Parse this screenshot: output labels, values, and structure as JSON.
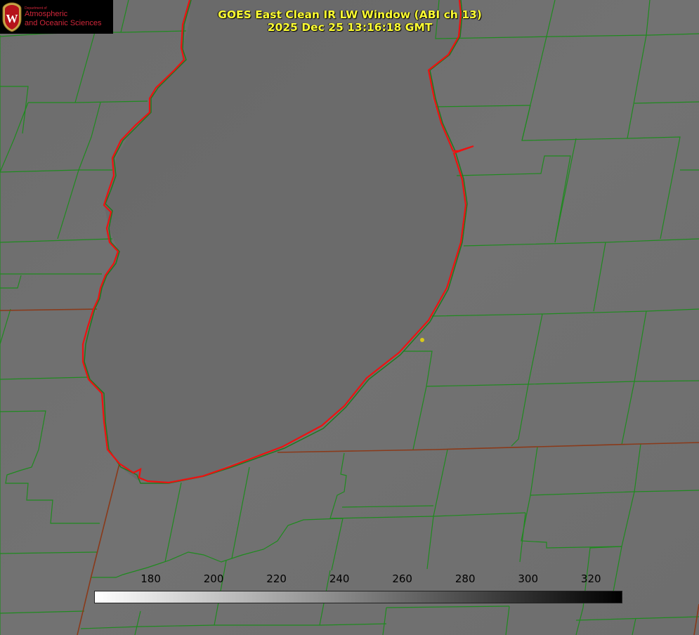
{
  "title": {
    "line1": "GOES East Clean IR LW Window (ABI ch 13)",
    "line2": "2025 Dec 25 13:16:18 GMT"
  },
  "logo": {
    "department": "Department of",
    "name_line1": "Atmospheric",
    "name_line2": "and Oceanic Sciences",
    "crest_letter": "W"
  },
  "colorbar": {
    "ticks": [
      "180",
      "200",
      "220",
      "240",
      "260",
      "280",
      "300",
      "320"
    ],
    "range": [
      162,
      330
    ],
    "gradient": [
      "#ffffff",
      "#000000"
    ]
  },
  "colors": {
    "county_lines": "#1f8a1f",
    "state_lines": "#8a3a1a",
    "lake_outline": "#ee1111",
    "marker": "#d8c81a",
    "title": "#ffff33"
  },
  "map": {
    "features": [
      "county-boundaries",
      "state-boundaries",
      "lake-outline",
      "station-marker"
    ]
  }
}
